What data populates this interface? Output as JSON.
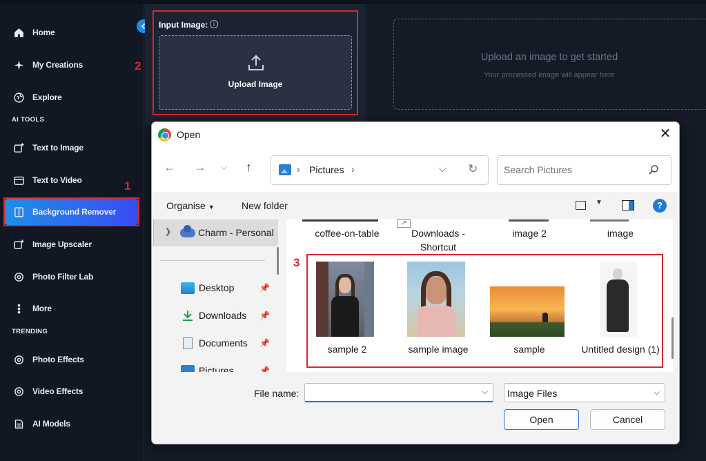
{
  "sidebar": {
    "nav": [
      {
        "label": "Home",
        "icon": "home-icon"
      },
      {
        "label": "My Creations",
        "icon": "sparkle-icon"
      },
      {
        "label": "Explore",
        "icon": "globe-icon"
      }
    ],
    "ai_tools_heading": "AI TOOLS",
    "ai_tools": [
      {
        "label": "Text to Image",
        "icon": "image-plus-icon"
      },
      {
        "label": "Text to Video",
        "icon": "video-icon"
      },
      {
        "label": "Background Remover",
        "icon": "bg-remover-icon",
        "active": true
      },
      {
        "label": "Image Upscaler",
        "icon": "upscale-icon"
      },
      {
        "label": "Photo Filter Lab",
        "icon": "filter-icon"
      },
      {
        "label": "More",
        "icon": "more-dots-icon"
      }
    ],
    "trending_heading": "TRENDING",
    "trending": [
      {
        "label": "Photo Effects",
        "icon": "photo-effects-icon"
      },
      {
        "label": "Video Effects",
        "icon": "video-effects-icon"
      },
      {
        "label": "AI Models",
        "icon": "ai-models-icon"
      }
    ]
  },
  "annotations": {
    "step1": "1",
    "step2": "2",
    "step3": "3"
  },
  "input_panel": {
    "label": "Input Image:",
    "info": "i",
    "upload_label": "Upload Image"
  },
  "preview": {
    "title": "Upload an image to get started",
    "subtitle": "Your processed image will appear here"
  },
  "dialog": {
    "title": "Open",
    "close": "✕",
    "address": {
      "location": "Pictures"
    },
    "search_placeholder": "Search Pictures",
    "toolbar": {
      "organise": "Organise",
      "new_folder": "New folder",
      "help": "?"
    },
    "nav_pane": {
      "charm": "Charm - Personal",
      "quick_access": [
        {
          "label": "Desktop",
          "icon": "desktop-icon"
        },
        {
          "label": "Downloads",
          "icon": "download-icon"
        },
        {
          "label": "Documents",
          "icon": "document-icon"
        },
        {
          "label": "Pictures",
          "icon": "pictures-icon"
        }
      ]
    },
    "files_top": [
      {
        "label": "coffee-on-table"
      },
      {
        "label": "Downloads - Shortcut"
      },
      {
        "label": "image 2"
      },
      {
        "label": "image"
      }
    ],
    "files_samples": [
      {
        "label": "sample 2"
      },
      {
        "label": "sample image"
      },
      {
        "label": "sample"
      },
      {
        "label": "Untitled design (1)"
      }
    ],
    "filename_label": "File name:",
    "filename_value": "",
    "filetype": "Image Files",
    "open_button": "Open",
    "cancel_button": "Cancel"
  },
  "colors": {
    "accent": "#1f8fe6",
    "annotation": "#d9262c",
    "bg": "#141a26"
  }
}
